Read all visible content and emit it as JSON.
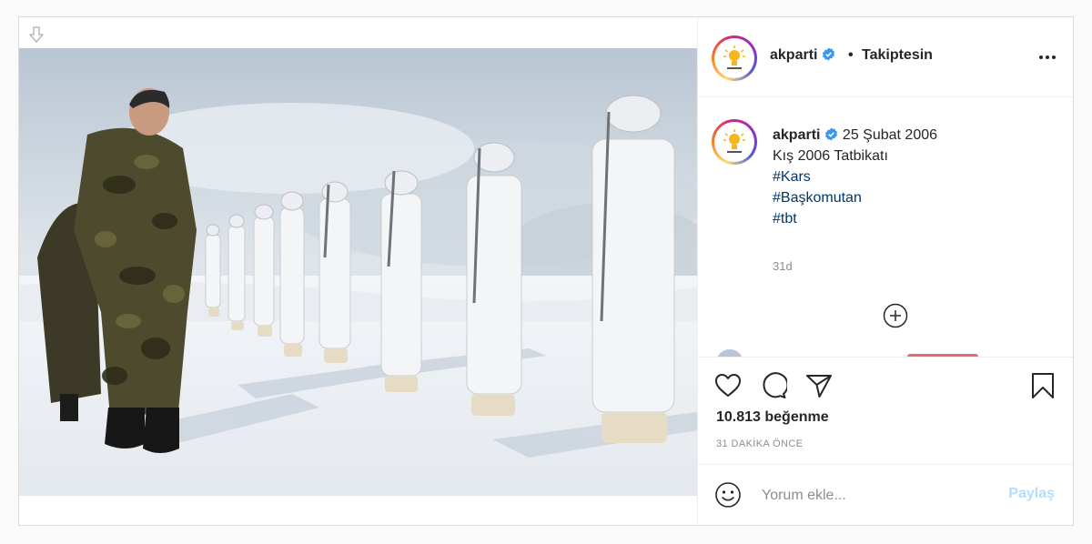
{
  "post": {
    "username": "akparti",
    "follow_status": "Takiptesin",
    "separator": "•",
    "caption": {
      "username": "akparti",
      "text_first": "25 Şubat 2006",
      "text_second": "Kış 2006 Tatbikatı",
      "hashtags": [
        "#Kars",
        "#Başkomutan",
        "#tbt"
      ],
      "time": "31d"
    },
    "likes": "10.813 beğenme",
    "time_ago": "31 DAKİKA ÖNCE",
    "comment_placeholder": "Yorum ekle...",
    "share_label": "Paylaş"
  },
  "icons": {
    "download": "arrow-down-icon",
    "more": "ellipsis-icon",
    "verified": "verified-badge-icon",
    "load_more": "plus-circle-icon",
    "like": "heart-icon",
    "comment": "speech-bubble-icon",
    "share": "paper-plane-icon",
    "save": "bookmark-icon",
    "emoji": "smiley-icon"
  },
  "colors": {
    "verified": "#3897f0",
    "hashtag": "#00376b",
    "share_disabled": "#b2dffc",
    "secondary_text": "#8e8e8e",
    "logo_yellow": "#f6b51b"
  }
}
